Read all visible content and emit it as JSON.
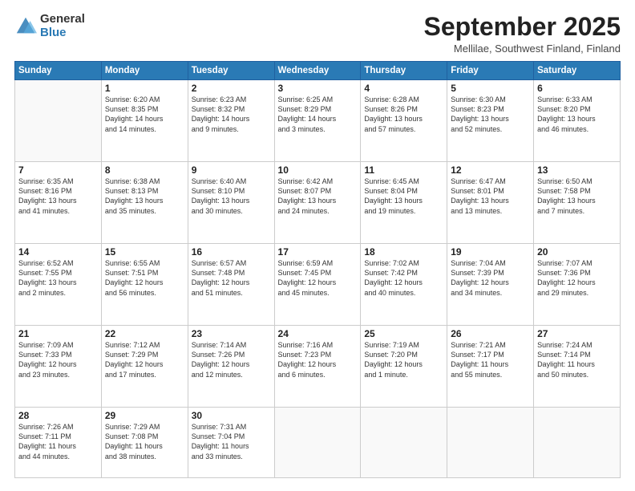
{
  "logo": {
    "general": "General",
    "blue": "Blue"
  },
  "title": "September 2025",
  "location": "Mellilae, Southwest Finland, Finland",
  "days": [
    "Sunday",
    "Monday",
    "Tuesday",
    "Wednesday",
    "Thursday",
    "Friday",
    "Saturday"
  ],
  "weeks": [
    [
      {
        "day": "",
        "content": ""
      },
      {
        "day": "1",
        "content": "Sunrise: 6:20 AM\nSunset: 8:35 PM\nDaylight: 14 hours\nand 14 minutes."
      },
      {
        "day": "2",
        "content": "Sunrise: 6:23 AM\nSunset: 8:32 PM\nDaylight: 14 hours\nand 9 minutes."
      },
      {
        "day": "3",
        "content": "Sunrise: 6:25 AM\nSunset: 8:29 PM\nDaylight: 14 hours\nand 3 minutes."
      },
      {
        "day": "4",
        "content": "Sunrise: 6:28 AM\nSunset: 8:26 PM\nDaylight: 13 hours\nand 57 minutes."
      },
      {
        "day": "5",
        "content": "Sunrise: 6:30 AM\nSunset: 8:23 PM\nDaylight: 13 hours\nand 52 minutes."
      },
      {
        "day": "6",
        "content": "Sunrise: 6:33 AM\nSunset: 8:20 PM\nDaylight: 13 hours\nand 46 minutes."
      }
    ],
    [
      {
        "day": "7",
        "content": "Sunrise: 6:35 AM\nSunset: 8:16 PM\nDaylight: 13 hours\nand 41 minutes."
      },
      {
        "day": "8",
        "content": "Sunrise: 6:38 AM\nSunset: 8:13 PM\nDaylight: 13 hours\nand 35 minutes."
      },
      {
        "day": "9",
        "content": "Sunrise: 6:40 AM\nSunset: 8:10 PM\nDaylight: 13 hours\nand 30 minutes."
      },
      {
        "day": "10",
        "content": "Sunrise: 6:42 AM\nSunset: 8:07 PM\nDaylight: 13 hours\nand 24 minutes."
      },
      {
        "day": "11",
        "content": "Sunrise: 6:45 AM\nSunset: 8:04 PM\nDaylight: 13 hours\nand 19 minutes."
      },
      {
        "day": "12",
        "content": "Sunrise: 6:47 AM\nSunset: 8:01 PM\nDaylight: 13 hours\nand 13 minutes."
      },
      {
        "day": "13",
        "content": "Sunrise: 6:50 AM\nSunset: 7:58 PM\nDaylight: 13 hours\nand 7 minutes."
      }
    ],
    [
      {
        "day": "14",
        "content": "Sunrise: 6:52 AM\nSunset: 7:55 PM\nDaylight: 13 hours\nand 2 minutes."
      },
      {
        "day": "15",
        "content": "Sunrise: 6:55 AM\nSunset: 7:51 PM\nDaylight: 12 hours\nand 56 minutes."
      },
      {
        "day": "16",
        "content": "Sunrise: 6:57 AM\nSunset: 7:48 PM\nDaylight: 12 hours\nand 51 minutes."
      },
      {
        "day": "17",
        "content": "Sunrise: 6:59 AM\nSunset: 7:45 PM\nDaylight: 12 hours\nand 45 minutes."
      },
      {
        "day": "18",
        "content": "Sunrise: 7:02 AM\nSunset: 7:42 PM\nDaylight: 12 hours\nand 40 minutes."
      },
      {
        "day": "19",
        "content": "Sunrise: 7:04 AM\nSunset: 7:39 PM\nDaylight: 12 hours\nand 34 minutes."
      },
      {
        "day": "20",
        "content": "Sunrise: 7:07 AM\nSunset: 7:36 PM\nDaylight: 12 hours\nand 29 minutes."
      }
    ],
    [
      {
        "day": "21",
        "content": "Sunrise: 7:09 AM\nSunset: 7:33 PM\nDaylight: 12 hours\nand 23 minutes."
      },
      {
        "day": "22",
        "content": "Sunrise: 7:12 AM\nSunset: 7:29 PM\nDaylight: 12 hours\nand 17 minutes."
      },
      {
        "day": "23",
        "content": "Sunrise: 7:14 AM\nSunset: 7:26 PM\nDaylight: 12 hours\nand 12 minutes."
      },
      {
        "day": "24",
        "content": "Sunrise: 7:16 AM\nSunset: 7:23 PM\nDaylight: 12 hours\nand 6 minutes."
      },
      {
        "day": "25",
        "content": "Sunrise: 7:19 AM\nSunset: 7:20 PM\nDaylight: 12 hours\nand 1 minute."
      },
      {
        "day": "26",
        "content": "Sunrise: 7:21 AM\nSunset: 7:17 PM\nDaylight: 11 hours\nand 55 minutes."
      },
      {
        "day": "27",
        "content": "Sunrise: 7:24 AM\nSunset: 7:14 PM\nDaylight: 11 hours\nand 50 minutes."
      }
    ],
    [
      {
        "day": "28",
        "content": "Sunrise: 7:26 AM\nSunset: 7:11 PM\nDaylight: 11 hours\nand 44 minutes."
      },
      {
        "day": "29",
        "content": "Sunrise: 7:29 AM\nSunset: 7:08 PM\nDaylight: 11 hours\nand 38 minutes."
      },
      {
        "day": "30",
        "content": "Sunrise: 7:31 AM\nSunset: 7:04 PM\nDaylight: 11 hours\nand 33 minutes."
      },
      {
        "day": "",
        "content": ""
      },
      {
        "day": "",
        "content": ""
      },
      {
        "day": "",
        "content": ""
      },
      {
        "day": "",
        "content": ""
      }
    ]
  ]
}
